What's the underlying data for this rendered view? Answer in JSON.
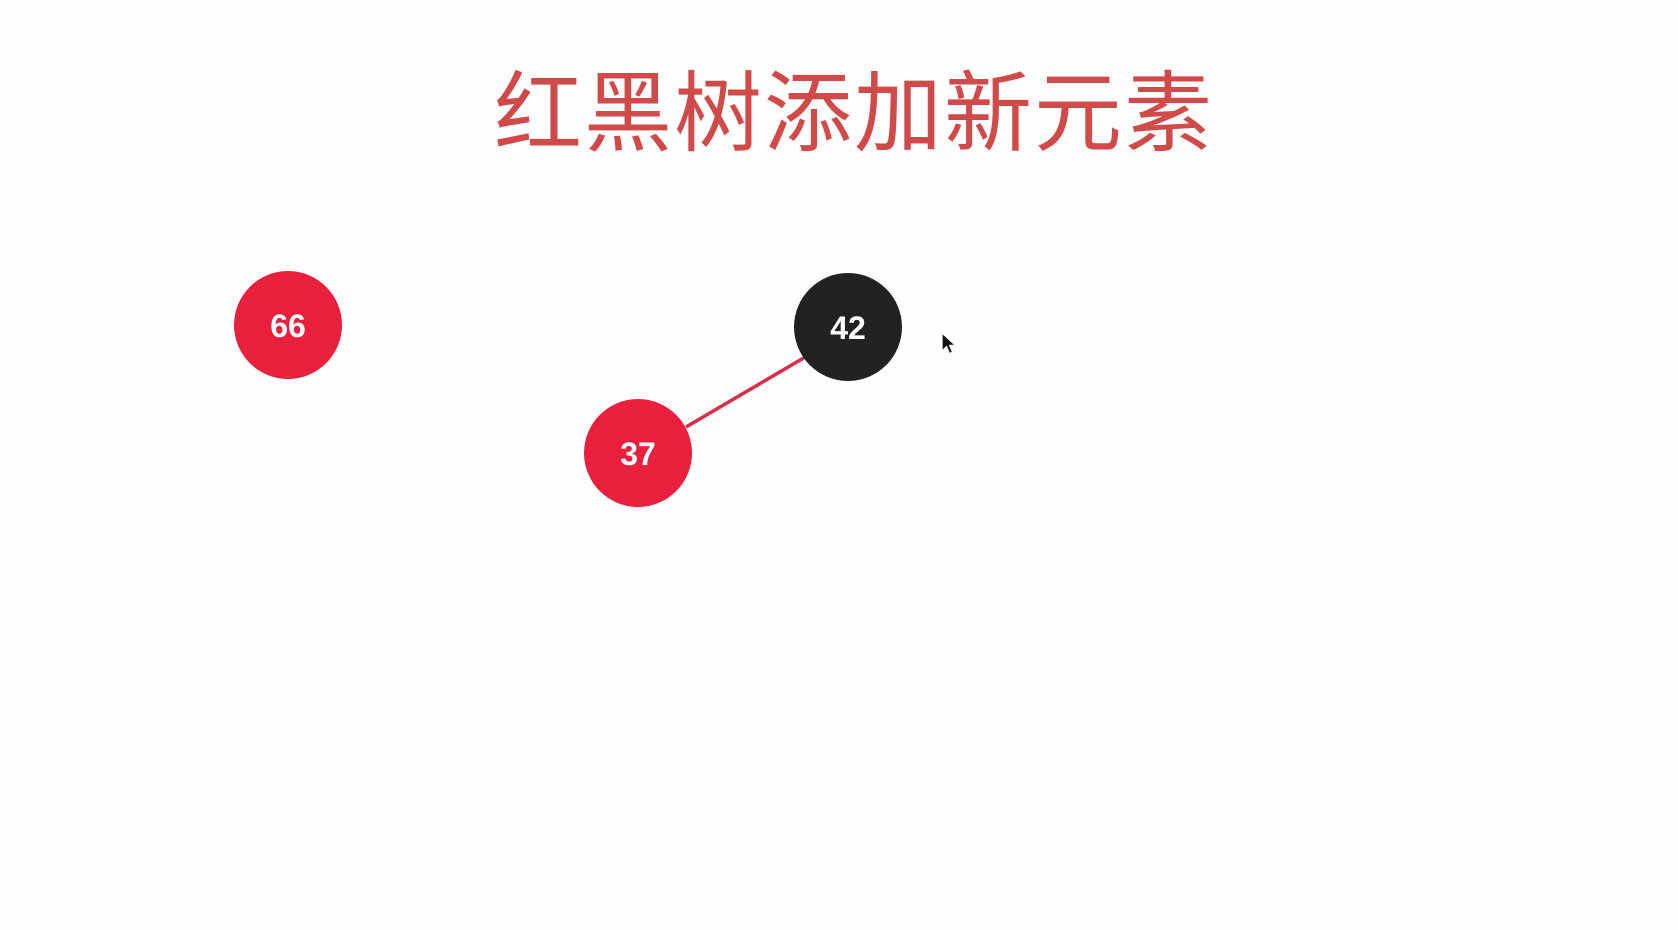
{
  "title": "红黑树添加新元素",
  "colors": {
    "title": "#d04a49",
    "red_node": "#e8203e",
    "black_node": "#222222",
    "red_edge": "#d92e48",
    "label": "#ffffff"
  },
  "nodes": [
    {
      "id": "n66",
      "label": "66",
      "color": "red"
    },
    {
      "id": "n42",
      "label": "42",
      "color": "black"
    },
    {
      "id": "n37",
      "label": "37",
      "color": "red"
    }
  ],
  "edges": [
    {
      "from": "n42",
      "to": "n37",
      "color": "red"
    }
  ]
}
